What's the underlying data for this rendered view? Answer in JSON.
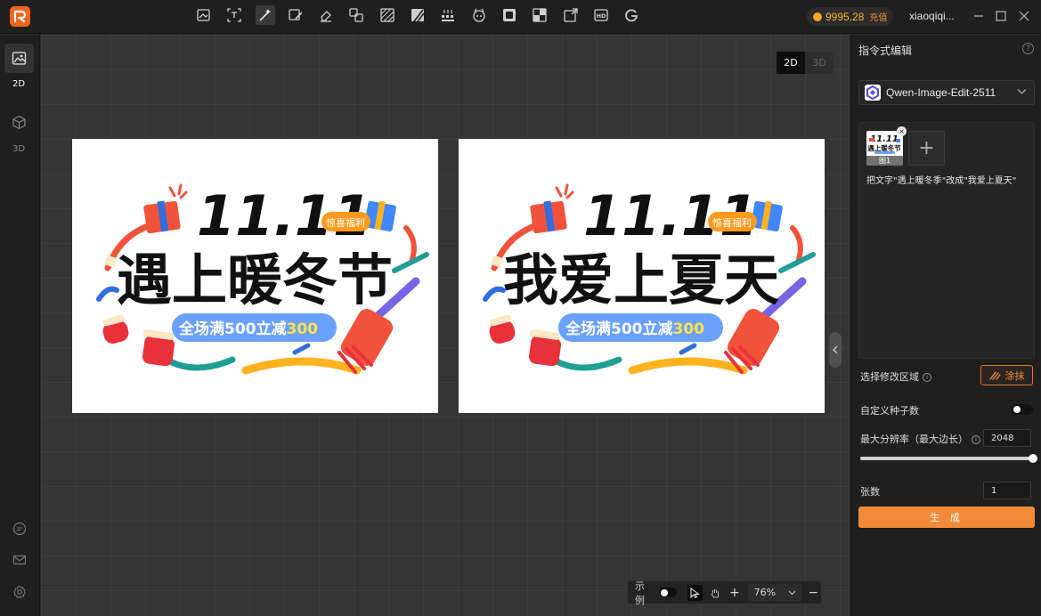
{
  "titlebar": {
    "tools": [
      {
        "name": "image-edit-icon",
        "active": false
      },
      {
        "name": "text-recognize-icon",
        "active": false
      },
      {
        "name": "magic-wand-icon",
        "active": true
      },
      {
        "name": "brush-edit-icon",
        "active": false
      },
      {
        "name": "eraser-icon",
        "active": false
      },
      {
        "name": "crop-replace-icon",
        "active": false
      },
      {
        "name": "texture-icon",
        "active": false
      },
      {
        "name": "stripe-icon",
        "active": false
      },
      {
        "name": "grid-boxes-icon",
        "active": false
      },
      {
        "name": "cat-face-icon",
        "active": false
      },
      {
        "name": "layers-icon",
        "active": false
      },
      {
        "name": "cutout-icon",
        "active": false
      },
      {
        "name": "image-export-icon",
        "active": false
      },
      {
        "name": "hd-icon",
        "active": false
      },
      {
        "name": "google-icon",
        "active": false
      }
    ],
    "coins": "9995.28",
    "recharge": "充值",
    "username": "xiaoqiqi..."
  },
  "leftrail": {
    "tab_2d": "2D",
    "tab_3d": "3D"
  },
  "canvas": {
    "toggle_2d": "2D",
    "toggle_3d": "3D",
    "left_art": {
      "title": "11.11",
      "tag": "惊喜福利",
      "headline": "遇上暖冬节",
      "banner_main": "全场满500立减",
      "banner_num": "300"
    },
    "right_art": {
      "title": "11.11",
      "tag": "惊喜福利",
      "headline": "我爱上夏天",
      "banner_main": "全场满500立减",
      "banner_num": "300"
    }
  },
  "zoombar": {
    "example_label": "示例",
    "zoom": "76%",
    "plus": "+",
    "minus": "−"
  },
  "panel": {
    "title": "指令式编辑",
    "model": "Qwen-Image-Edit-2511",
    "thumb_title": "11.11",
    "thumb_headline": "遇上暖冬节",
    "thumb_label": "图1",
    "prompt": "把文字\"遇上暖冬季\"改成\"我爱上夏天\"",
    "region_label": "选择修改区域",
    "paint_label": "涂抹",
    "seed_label": "自定义种子数",
    "resolution_label": "最大分辨率（最大边长）",
    "resolution_value": "2048",
    "resolution_fraction": 1.0,
    "count_label": "张数",
    "count_value": "1",
    "generate_label": "生 成"
  },
  "colors": {
    "accent": "#f28a38",
    "coin": "#f5b53a"
  }
}
